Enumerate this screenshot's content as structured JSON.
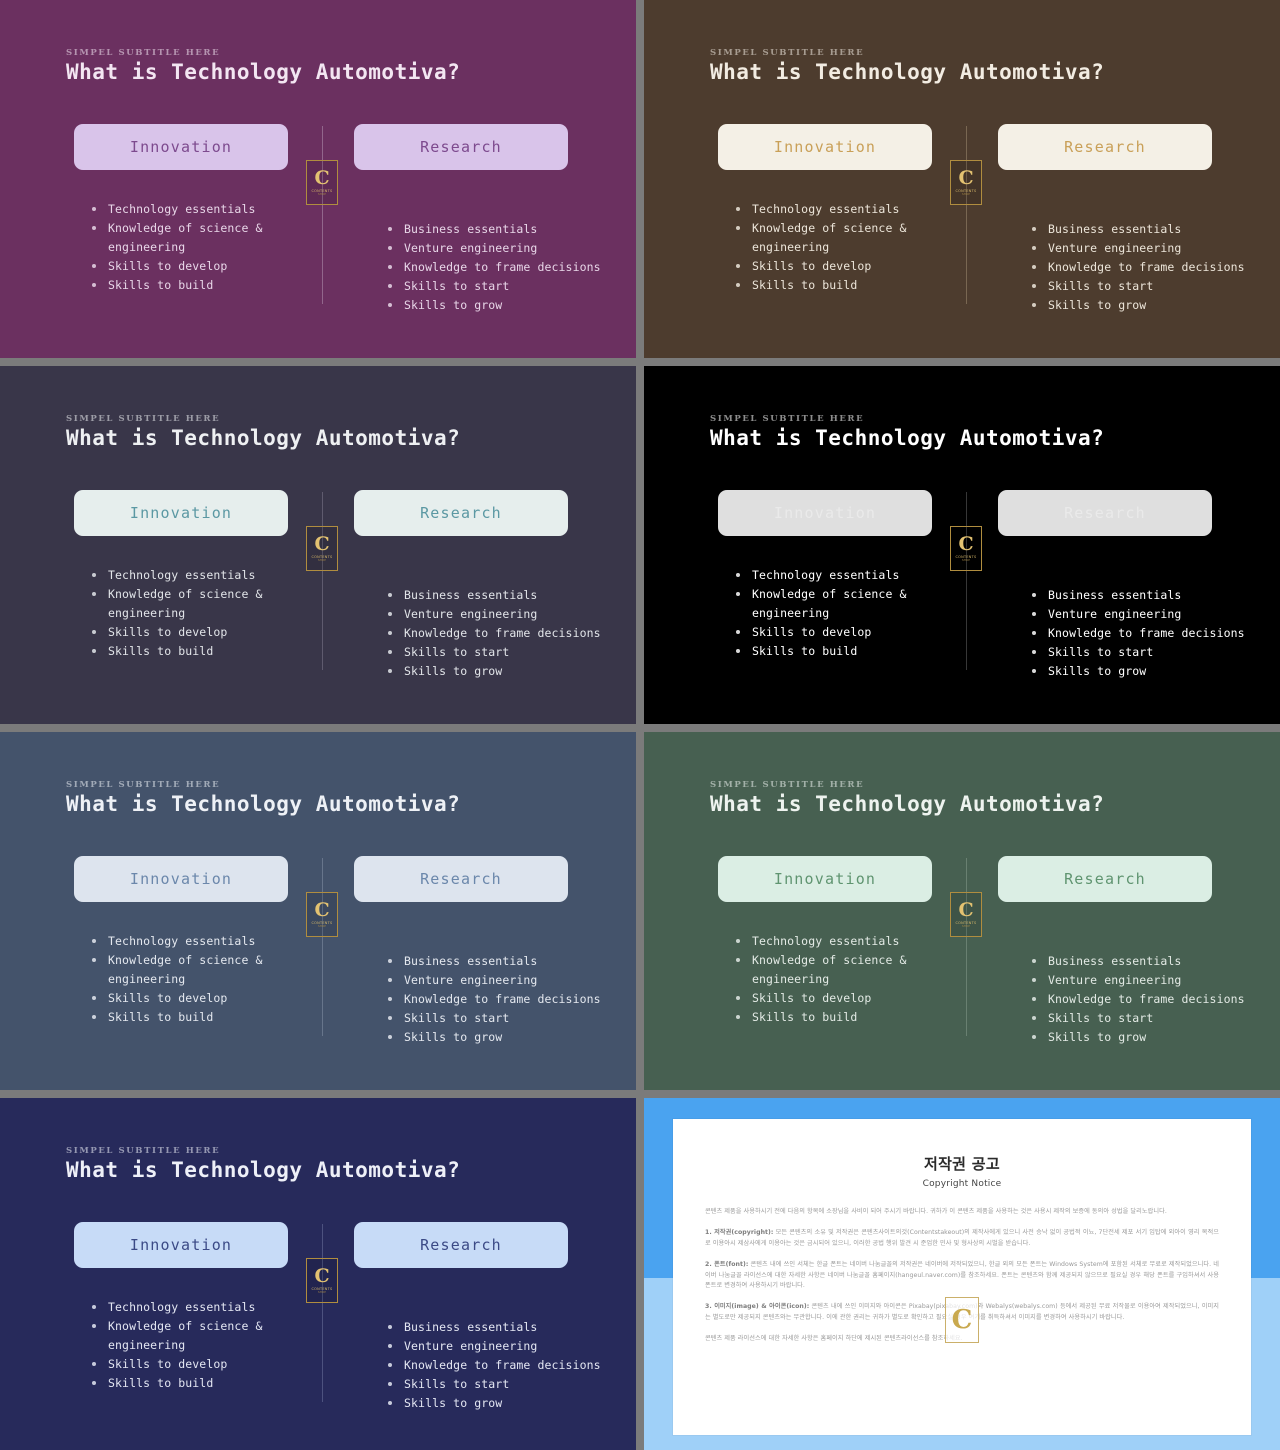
{
  "slide": {
    "subtitle": "SIMPEL SUBTITLE HERE",
    "title": "What is Technology Automotiva?",
    "left_card": "Innovation",
    "right_card": "Research",
    "left_bullets": [
      "Technology essentials",
      "Knowledge of science & engineering",
      "Skills to develop",
      "Skills to build"
    ],
    "right_bullets": [
      "Business essentials",
      "Venture engineering",
      "Knowledge to frame decisions",
      "Skills to start",
      "Skills to grow"
    ],
    "badge": {
      "letter": "C",
      "line1": "CONTENTS",
      "line2": "SHOP"
    }
  },
  "themes": [
    {
      "id": "plum",
      "name": "Plum Purple",
      "background": "#6b3060",
      "card_bg": "#d9c4ea",
      "card_text": "#7d4a8e"
    },
    {
      "id": "brown",
      "name": "Dark Brown",
      "background": "#4d3c2e",
      "card_bg": "#f4f0e6",
      "card_text": "#c9a058"
    },
    {
      "id": "slate",
      "name": "Slate Purple",
      "background": "#393649",
      "card_bg": "#e6eeed",
      "card_text": "#5b98a3"
    },
    {
      "id": "black",
      "name": "Black",
      "background": "#000000",
      "card_bg": "#dfdfdf",
      "card_text": "#eaeaea"
    },
    {
      "id": "steel",
      "name": "Steel Blue",
      "background": "#44536b",
      "card_bg": "#dde4ee",
      "card_text": "#6b87ab"
    },
    {
      "id": "green",
      "name": "Forest Green",
      "background": "#476051",
      "card_bg": "#dbeee4",
      "card_text": "#5f9470"
    },
    {
      "id": "navy",
      "name": "Navy",
      "background": "#272a5b",
      "card_bg": "#c7dbf7",
      "card_text": "#3b4a86"
    }
  ],
  "copyright": {
    "title": "저작권 공고",
    "subtitle": "Copyright Notice",
    "intro": "콘텐츠 제품을 사용하시기 전에 다음의 항목에 소장님을 사비이 되어 주시기 바랍니다. 귀하가 이 콘텐츠 제품을 사용하는 것은 사용시 제작의 보증에 동의아 성법을 달리노랍니다.",
    "items": [
      {
        "label": "1. 저작권(copyright):",
        "text": " 모든 콘텐츠의 소유 및 저작권은 콘텐츠사이트의것(Contentstakeout)의 제작사에게 있으니 사전 승낙 없이 공법적 이뇨, 7단전세 제포 서기 임탑에 외아이 영리 목적으로 이용아시 제삼사에게 이용아는 것은 금시되어 있으니, 이러한 공법 행위 발견 시 준업한 민사 및 형사상의 시벌을 받습니다."
      },
      {
        "label": "2. 폰트(font):",
        "text": " 콘텐츠 내에 쓰인 서체는 한글 폰트는 네이버 나눔글꼴의 저작권은 네이버에 저작되었으니, 한글 외의 모든 폰트는 Windows System에 포함된 서체로 무료로 제작되었으니다. 네이버 나눔글꼴 라이선스에 대한 자세한 사항은 네이버 나눔글꼴 홈페이지(hangeul.naver.com)를 참조하세요. 폰트는 콘텐츠와 함께 제공되지 않으므로 필요실 경우 해당 폰트를 구입하셔서 사용폰트로 변경하여 사용하시기 바랍니다."
      },
      {
        "label": "3. 이미지(image) & 아이콘(icon):",
        "text": " 콘텐츠 내에 쓰인 이미지와 아이콘은 Pixabay(pixabay.com)와 Webalys(webalys.com) 등에서 제공된 무료 저작물로 이용아여 제작되었으니, 이미지는 별도로만 제공되지 콘텐츠와는 무관합니다. 이에 관한 권리는 귀하가 별도로 확인하고 필요실 경우 여기를 취득하셔서 이미지를 변경하여 사용하시기 바랍니다."
      }
    ],
    "footer": "콘텐츠 제품 라이선스에 대한 자세한 사항은 홈페이지 하단에 제시된 콘텐츠라이선스를 참조하세요.",
    "watermark_letter": "C"
  }
}
